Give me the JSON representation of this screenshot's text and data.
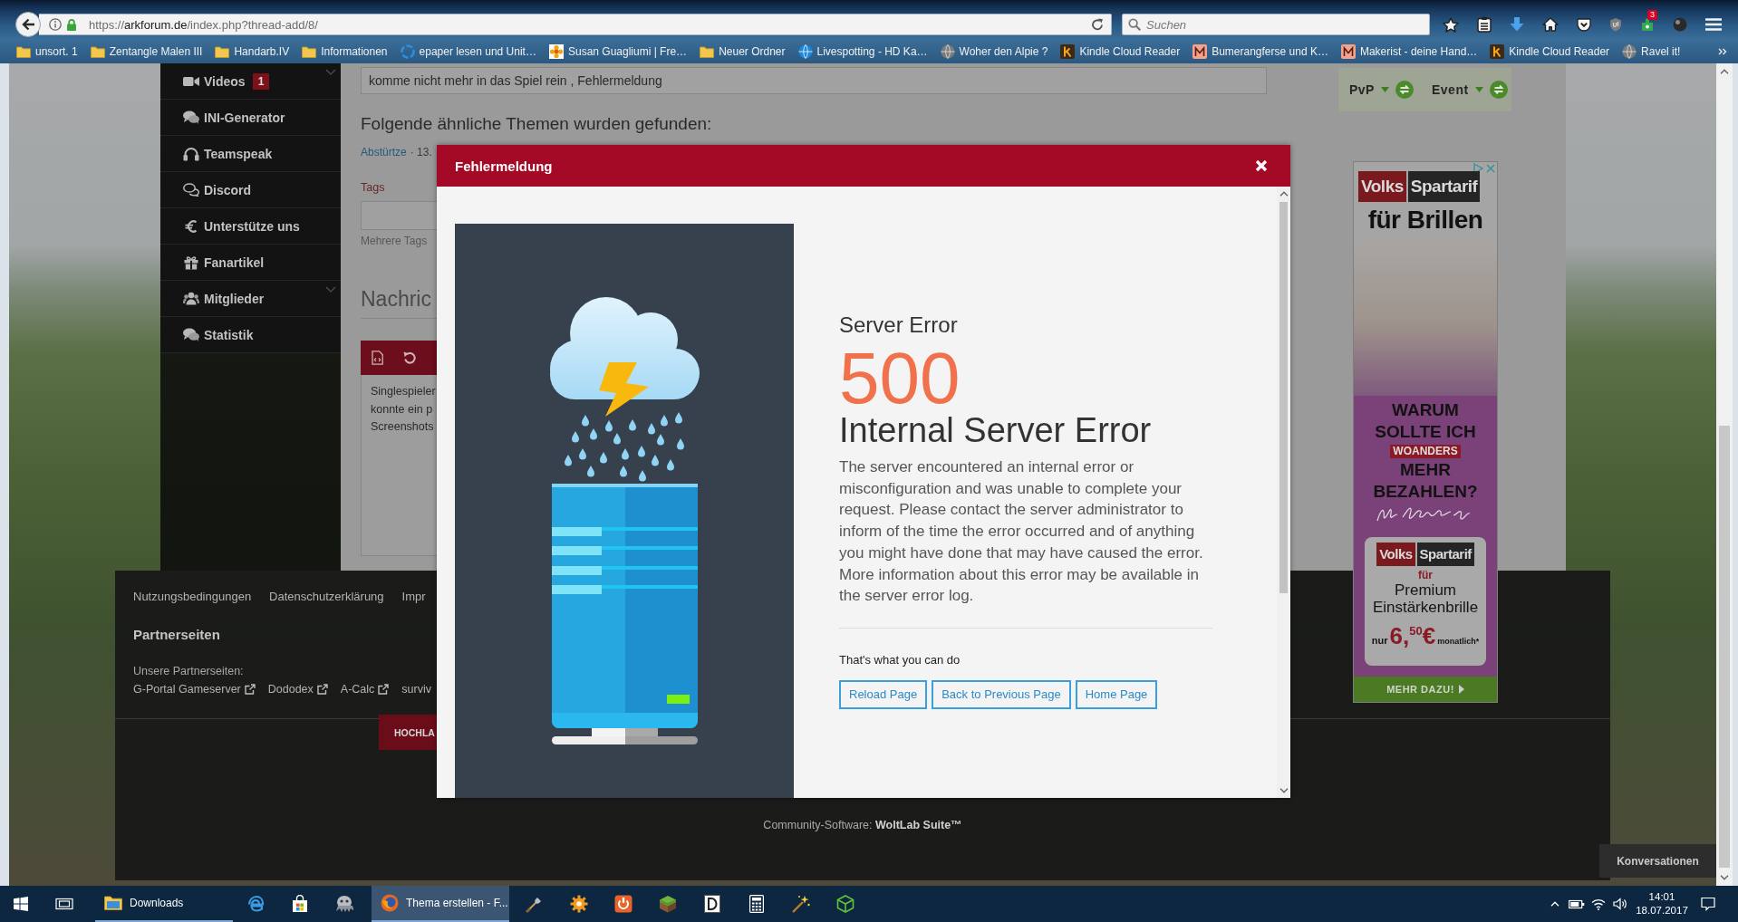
{
  "browser": {
    "url": "https://**arkforum.de**/index.php?thread-add/8/",
    "search_placeholder": "Suchen",
    "addon_badge": "3"
  },
  "bookmarks": [
    {
      "label": "unsort. 1",
      "kind": "folder"
    },
    {
      "label": "Zentangle Malen III",
      "kind": "folder"
    },
    {
      "label": "Handarb.IV",
      "kind": "folder"
    },
    {
      "label": "Informationen",
      "kind": "folder"
    },
    {
      "label": "epaper lesen und Unit…",
      "kind": "link"
    },
    {
      "label": "Susan Guagliumi | Fre…",
      "kind": "link"
    },
    {
      "label": "Neuer Ordner",
      "kind": "folder"
    },
    {
      "label": "Livespotting - HD Ka…",
      "kind": "link"
    },
    {
      "label": "Woher den Alpie ?",
      "kind": "link"
    },
    {
      "label": "Kindle Cloud Reader",
      "kind": "link"
    },
    {
      "label": "Bumerangferse und K…",
      "kind": "link"
    },
    {
      "label": "Makerist - deine Hand…",
      "kind": "link"
    },
    {
      "label": "Kindle Cloud Reader",
      "kind": "link"
    },
    {
      "label": "Ravel it!",
      "kind": "link"
    }
  ],
  "sidebar": {
    "items": [
      {
        "label": "Videos",
        "badge": "1",
        "expandable": true
      },
      {
        "label": "INI-Generator",
        "expandable": false
      },
      {
        "label": "Teamspeak",
        "expandable": false
      },
      {
        "label": "Discord",
        "expandable": false
      },
      {
        "label": "Unterstütze uns",
        "expandable": false
      },
      {
        "label": "Fanartikel",
        "expandable": false
      },
      {
        "label": "Mitglieder",
        "expandable": true
      },
      {
        "label": "Statistik",
        "expandable": false
      }
    ]
  },
  "thread_form": {
    "subject": "komme nicht mehr in das Spiel rein , Fehlermeldung",
    "similar_heading": "Folgende ähnliche Themen wurden gefunden:",
    "similar_topic": {
      "title": "Abstürtze",
      "meta": "· 13."
    },
    "tags_label": "Tags",
    "tags_hint": "Mehrere Tags",
    "message_heading": "Nachric",
    "editor_lines": [
      "Singlespieler",
      "konnte ein p",
      "Screenshots"
    ]
  },
  "server_filters": [
    {
      "label": "PvP"
    },
    {
      "label": "Event"
    }
  ],
  "ad": {
    "logo": {
      "first": "Volks",
      "second": "Spartarif"
    },
    "headline": "für Brillen",
    "slogan": [
      {
        "text": "WARUM",
        "kind": "plain"
      },
      {
        "text": "SOLLTE ICH",
        "kind": "plain"
      },
      {
        "text": "WOANDERS",
        "kind": "highlight"
      },
      {
        "text": "MEHR",
        "kind": "plain"
      },
      {
        "text": "BEZAHLEN?",
        "kind": "plain"
      }
    ],
    "offer": {
      "logo": {
        "first": "Volks",
        "second": "Spartarif"
      },
      "for": "für",
      "product": "Premium Einstärkenbrille",
      "price_prefix": "nur",
      "price": "6,$^{50}$€",
      "price_suffix": "monatlich*"
    },
    "cta": "MEHR DAZU!"
  },
  "footer": {
    "links": [
      "Nutzungsbedingungen",
      "Datenschutzerklärung",
      "Impr"
    ],
    "partners_heading": "Partnerseiten",
    "partners_intro": "Unsere Partnerseiten:",
    "partners": [
      {
        "label": "G-Portal Gameserver",
        "external": true
      },
      {
        "label": "Dododex",
        "external": true
      },
      {
        "label": "A-Calc",
        "external": true
      },
      {
        "label": "surviv",
        "external": false
      }
    ],
    "credit": "Community-Software: **WoltLab Suite™**"
  },
  "upload_button": "HOCHLA",
  "conversations_button": "Konversationen",
  "modal": {
    "title": "Fehlermeldung",
    "subtitle": "Server Error",
    "code": "500",
    "heading": "Internal Server Error",
    "message": "The server encountered an internal error or misconfiguration and was unable to complete your request. Please contact the server administrator to inform of the time the error occurred and of anything you might have done that may have caused the error. More information about this error may be available in the server error log.",
    "actions_label": "That's what you can do",
    "actions": [
      "Reload Page",
      "Back to Previous Page",
      "Home Page"
    ]
  },
  "taskbar": {
    "apps": [
      {
        "label": "Downloads",
        "selected": false
      },
      {
        "label": "Thema erstellen - F...",
        "selected": true
      }
    ],
    "time": "14:01",
    "date": "18.07.2017"
  }
}
